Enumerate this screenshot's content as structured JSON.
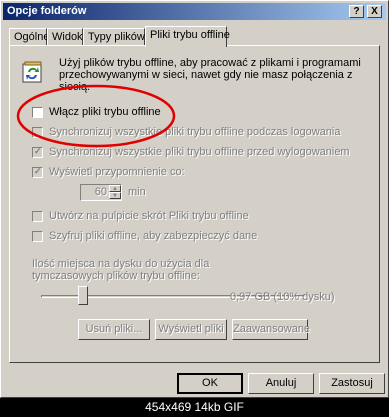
{
  "window": {
    "title": "Opcje folderów",
    "help_button": "?",
    "close_button": "X"
  },
  "tabs": [
    {
      "label": "Ogólne"
    },
    {
      "label": "Widok"
    },
    {
      "label": "Typy plików"
    },
    {
      "label": "Pliki trybu offline"
    }
  ],
  "intro_text": "Użyj plików trybu offline, aby pracować z plikami i programami przechowywanymi w sieci, nawet gdy nie masz połączenia z siecią.",
  "options": {
    "enable_offline": {
      "label": "Włącz pliki trybu offline",
      "checked": false
    },
    "sync_logon": {
      "label": "Synchronizuj wszystkie pliki trybu offline podczas logowania",
      "checked": false
    },
    "sync_logoff": {
      "label": "Synchronizuj wszystkie pliki trybu offline przed wylogowaniem",
      "checked": true
    },
    "reminders": {
      "label": "Wyświetl przypomnienie co:",
      "checked": true
    },
    "shortcut": {
      "label": "Utwórz na pulpicie skrót Pliki trybu offline",
      "checked": false
    },
    "encrypt": {
      "label": "Szyfruj pliki offline, aby zabezpieczyć dane",
      "checked": false
    }
  },
  "reminder_interval": {
    "value": "60",
    "unit": "min"
  },
  "disk_space": {
    "label": "Ilość miejsca na dysku do użycia dla tymczasowych plików trybu offline:",
    "value_text": "0,97 GB (10% dysku)",
    "percent": 10
  },
  "panel_buttons": {
    "delete": "Usuń pliki...",
    "view": "Wyświetl pliki",
    "advanced": "Zaawansowane"
  },
  "dialog_buttons": {
    "ok": "OK",
    "cancel": "Anuluj",
    "apply": "Zastosuj"
  },
  "caption": "454x469 14kb GIF",
  "colors": {
    "annotation": "#e00000",
    "titlebar_start": "#0a246a",
    "titlebar_end": "#a6caf0"
  }
}
